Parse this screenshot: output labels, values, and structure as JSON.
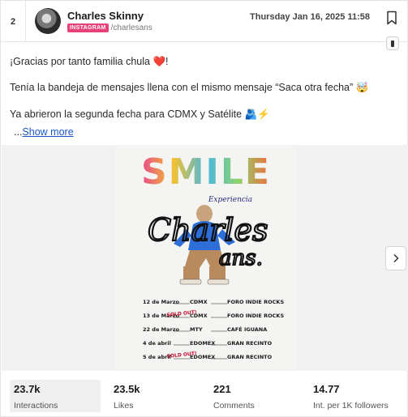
{
  "post": {
    "rank": "2",
    "author": "Charles Skinny",
    "platform": "INSTAGRAM",
    "handle": "/charlesans",
    "timestamp": "Thursday Jan 16, 2025 11:58",
    "text_lines": [
      "¡Gracias por tanto familia chula ❤️!",
      "Tenía la bandeja de mensajes llena con el mismo mensaje “Saca otra fecha” 🤯",
      "Ya abrieron la segunda fecha para CDMX y Satélite 🫂⚡"
    ],
    "ellipsis": "...",
    "show_more": "Show more"
  },
  "poster": {
    "headline": "SMILE",
    "subtitle": "Experiencia",
    "script": "Charles",
    "script2": "ans.",
    "dates": [
      {
        "date": "12 de Marzo",
        "city": "CDMX",
        "venue": "FORO INDIE ROCKS",
        "sold_out": false
      },
      {
        "date": "13 de Marzo",
        "city": "CDMX",
        "venue": "FORO INDIE ROCKS",
        "sold_out": true
      },
      {
        "date": "22 de Marzo",
        "city": "MTY",
        "venue": "CAFÉ IGUANA",
        "sold_out": false
      },
      {
        "date": "4 de abril",
        "city": "EDOMEX",
        "venue": "GRAN RECINTO",
        "sold_out": false
      },
      {
        "date": "5 de abril",
        "city": "EDOMEX",
        "venue": "GRAN RECINTO",
        "sold_out": true
      }
    ],
    "sold_out_label": "SOLD OUT!"
  },
  "stats": [
    {
      "value": "23.7k",
      "label": "Interactions"
    },
    {
      "value": "23.5k",
      "label": "Likes"
    },
    {
      "value": "221",
      "label": "Comments"
    },
    {
      "value": "14.77",
      "label": "Int. per 1K followers"
    }
  ],
  "colors": {
    "platform_badge": "#e6417a",
    "link": "#1a55c8",
    "active_stat_bg": "#efefef"
  }
}
